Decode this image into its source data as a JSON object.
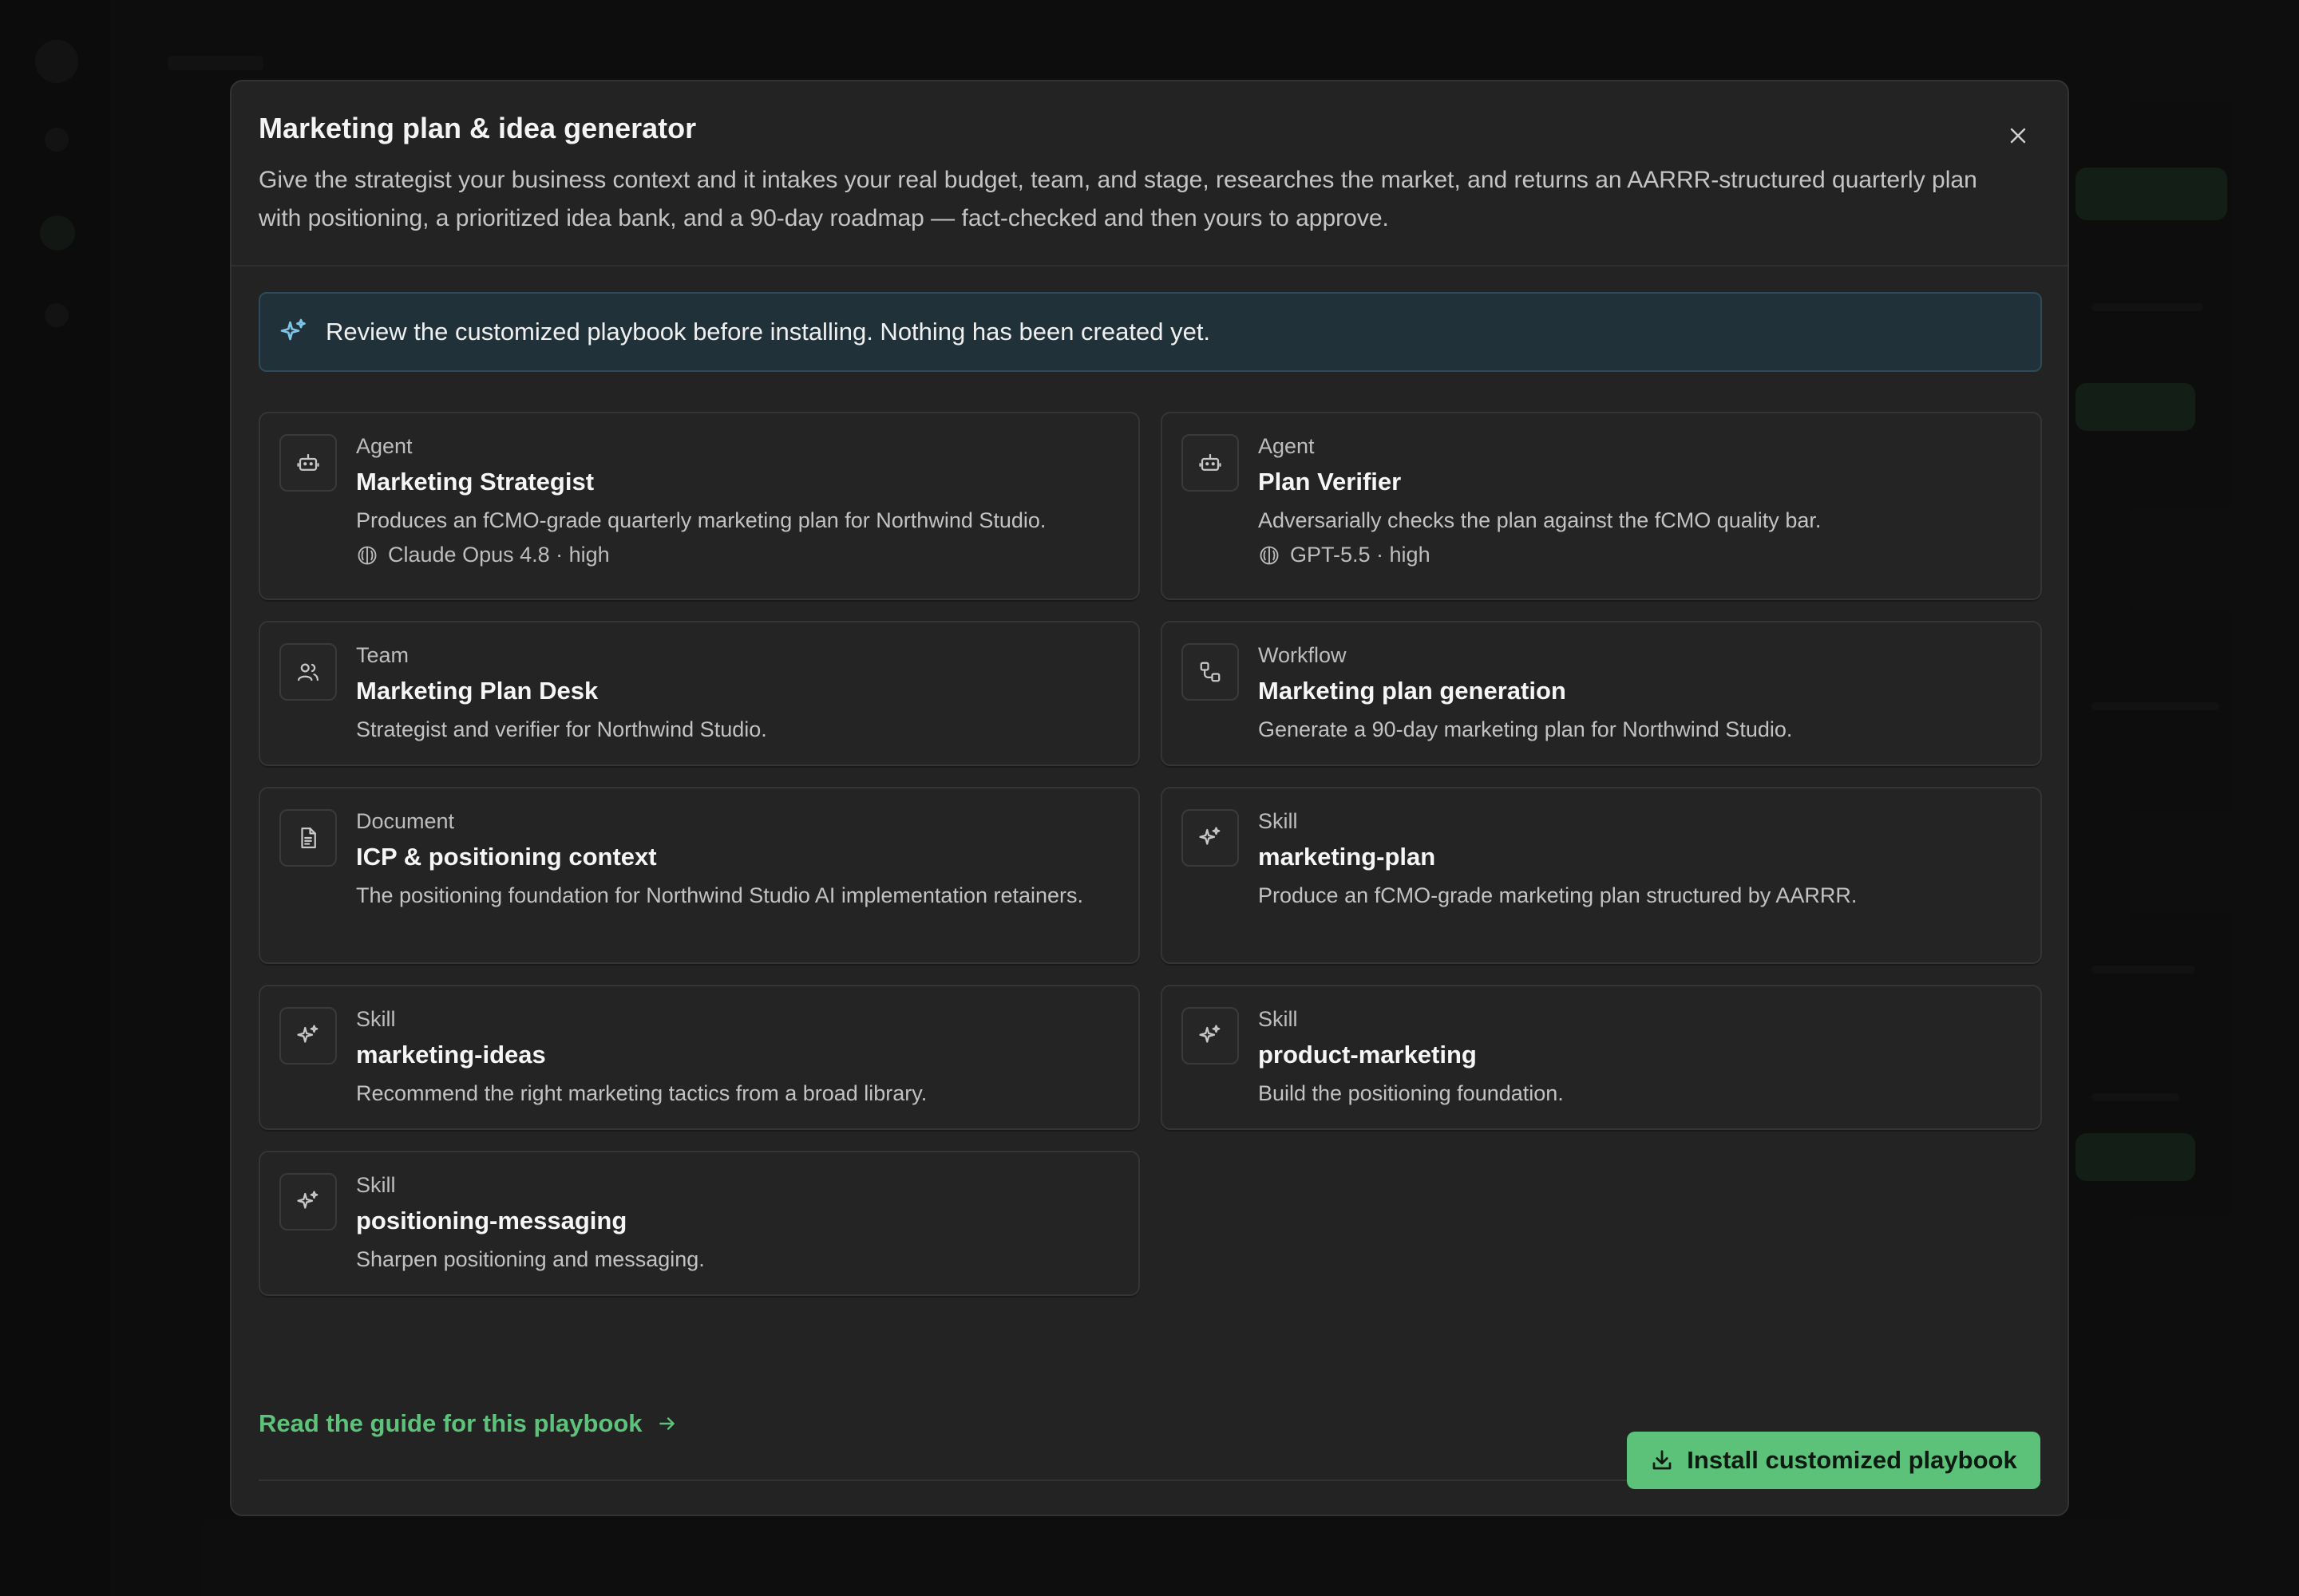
{
  "modal": {
    "title": "Marketing plan & idea generator",
    "description": "Give the strategist your business context and it intakes your real budget, team, and stage, researches the market, and returns an AARRR-structured quarterly plan with positioning, a prioritized idea bank, and a 90-day roadmap — fact-checked and then yours to approve.",
    "close_icon": "close-icon"
  },
  "notice": {
    "icon": "sparkles-icon",
    "text": "Review the customized playbook before installing. Nothing has been created yet."
  },
  "cards": [
    {
      "icon": "robot-icon",
      "type": "Agent",
      "title": "Marketing Strategist",
      "description": "Produces an fCMO-grade quarterly marketing plan for Northwind Studio.",
      "meta": "Claude Opus 4.8 · high",
      "meta_icon": "brain-icon"
    },
    {
      "icon": "robot-icon",
      "type": "Agent",
      "title": "Plan Verifier",
      "description": "Adversarially checks the plan against the fCMO quality bar.",
      "meta": "GPT-5.5 · high",
      "meta_icon": "brain-icon"
    },
    {
      "icon": "users-icon",
      "type": "Team",
      "title": "Marketing Plan Desk",
      "description": "Strategist and verifier for Northwind Studio."
    },
    {
      "icon": "workflow-icon",
      "type": "Workflow",
      "title": "Marketing plan generation",
      "description": "Generate a 90-day marketing plan for Northwind Studio."
    },
    {
      "icon": "document-icon",
      "type": "Document",
      "title": "ICP & positioning context",
      "description": "The positioning foundation for Northwind Studio AI implementation retainers."
    },
    {
      "icon": "sparkles-icon",
      "type": "Skill",
      "title": "marketing-plan",
      "description": "Produce an fCMO-grade marketing plan structured by AARRR."
    },
    {
      "icon": "sparkles-icon",
      "type": "Skill",
      "title": "marketing-ideas",
      "description": "Recommend the right marketing tactics from a broad library."
    },
    {
      "icon": "sparkles-icon",
      "type": "Skill",
      "title": "product-marketing",
      "description": "Build the positioning foundation."
    },
    {
      "icon": "sparkles-icon",
      "type": "Skill",
      "title": "positioning-messaging",
      "description": "Sharpen positioning and messaging."
    }
  ],
  "guide_link": {
    "label": "Read the guide for this playbook",
    "icon": "arrow-right-icon"
  },
  "install_button": {
    "label": "Install customized playbook",
    "icon": "download-icon"
  },
  "colors": {
    "accent_green": "#5cc279",
    "notice_bg": "#213139",
    "modal_bg": "#232323"
  }
}
